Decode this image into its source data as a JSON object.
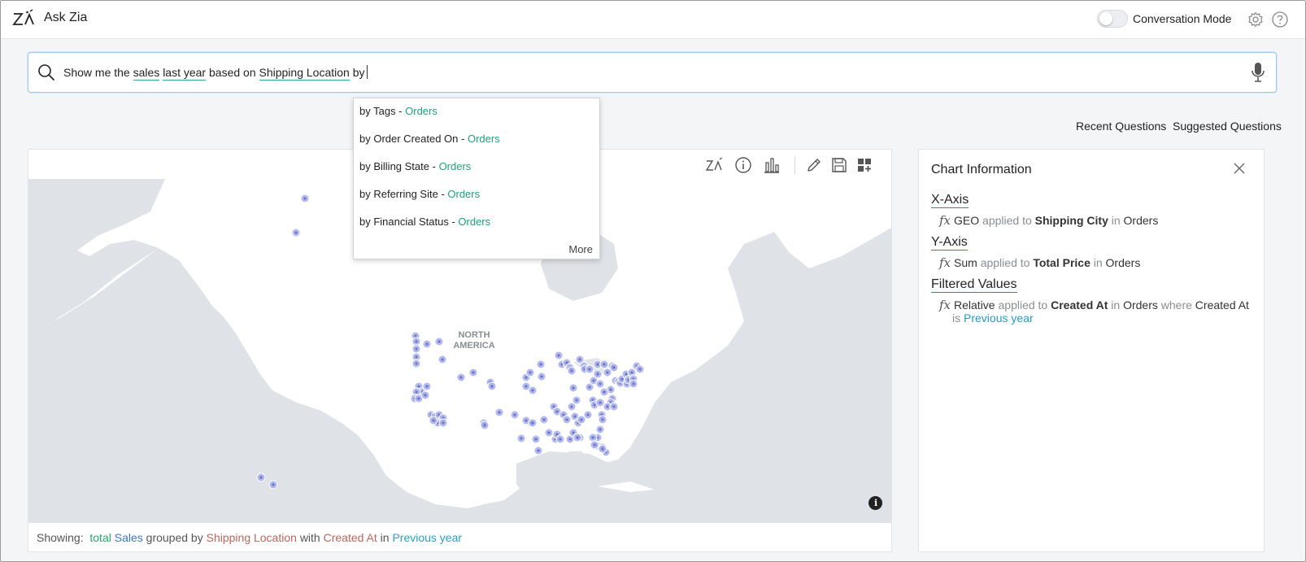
{
  "header": {
    "app_title": "Ask Zia",
    "conversation_mode_label": "Conversation Mode",
    "conversation_mode_on": false
  },
  "search": {
    "prefix": "Show me the",
    "token_sales": "sales",
    "token_last_year": "last year",
    "mid": "based on",
    "token_shipping_location": "Shipping Location",
    "suffix": "by"
  },
  "suggestions": {
    "items": [
      {
        "label": "by Tags -",
        "entity": "Orders"
      },
      {
        "label": "by Order Created On -",
        "entity": "Orders"
      },
      {
        "label": "by Billing State -",
        "entity": "Orders"
      },
      {
        "label": "by Referring Site -",
        "entity": "Orders"
      },
      {
        "label": "by Financial Status -",
        "entity": "Orders"
      }
    ],
    "more_label": "More"
  },
  "links": {
    "recent_questions": "Recent Questions",
    "suggested_questions": "Suggested Questions"
  },
  "map": {
    "region_label_line1": "NORTH",
    "region_label_line2": "AMERICA",
    "marker_color": "#a7aeea",
    "land_color": "#ffffff",
    "water_color": "#dfe2e6"
  },
  "showing": {
    "label": "Showing:",
    "aggregate": "total",
    "measure": "Sales",
    "grouped_by_text": "grouped by",
    "dimension": "Shipping Location",
    "with_text": "with",
    "filter_field": "Created At",
    "in_text": "in",
    "filter_value": "Previous year"
  },
  "info_panel": {
    "title": "Chart Information",
    "x_axis": {
      "heading": "X-Axis",
      "fn": "GEO",
      "applied_to": "applied to",
      "field": "Shipping City",
      "in": "in",
      "table": "Orders"
    },
    "y_axis": {
      "heading": "Y-Axis",
      "fn": "Sum",
      "applied_to": "applied to",
      "field": "Total Price",
      "in": "in",
      "table": "Orders"
    },
    "filtered": {
      "heading": "Filtered Values",
      "fn": "Relative",
      "applied_to": "applied to",
      "field": "Created At",
      "in": "in",
      "table": "Orders",
      "where": "where",
      "where_field": "Created At",
      "is": "is",
      "value": "Previous year"
    }
  }
}
